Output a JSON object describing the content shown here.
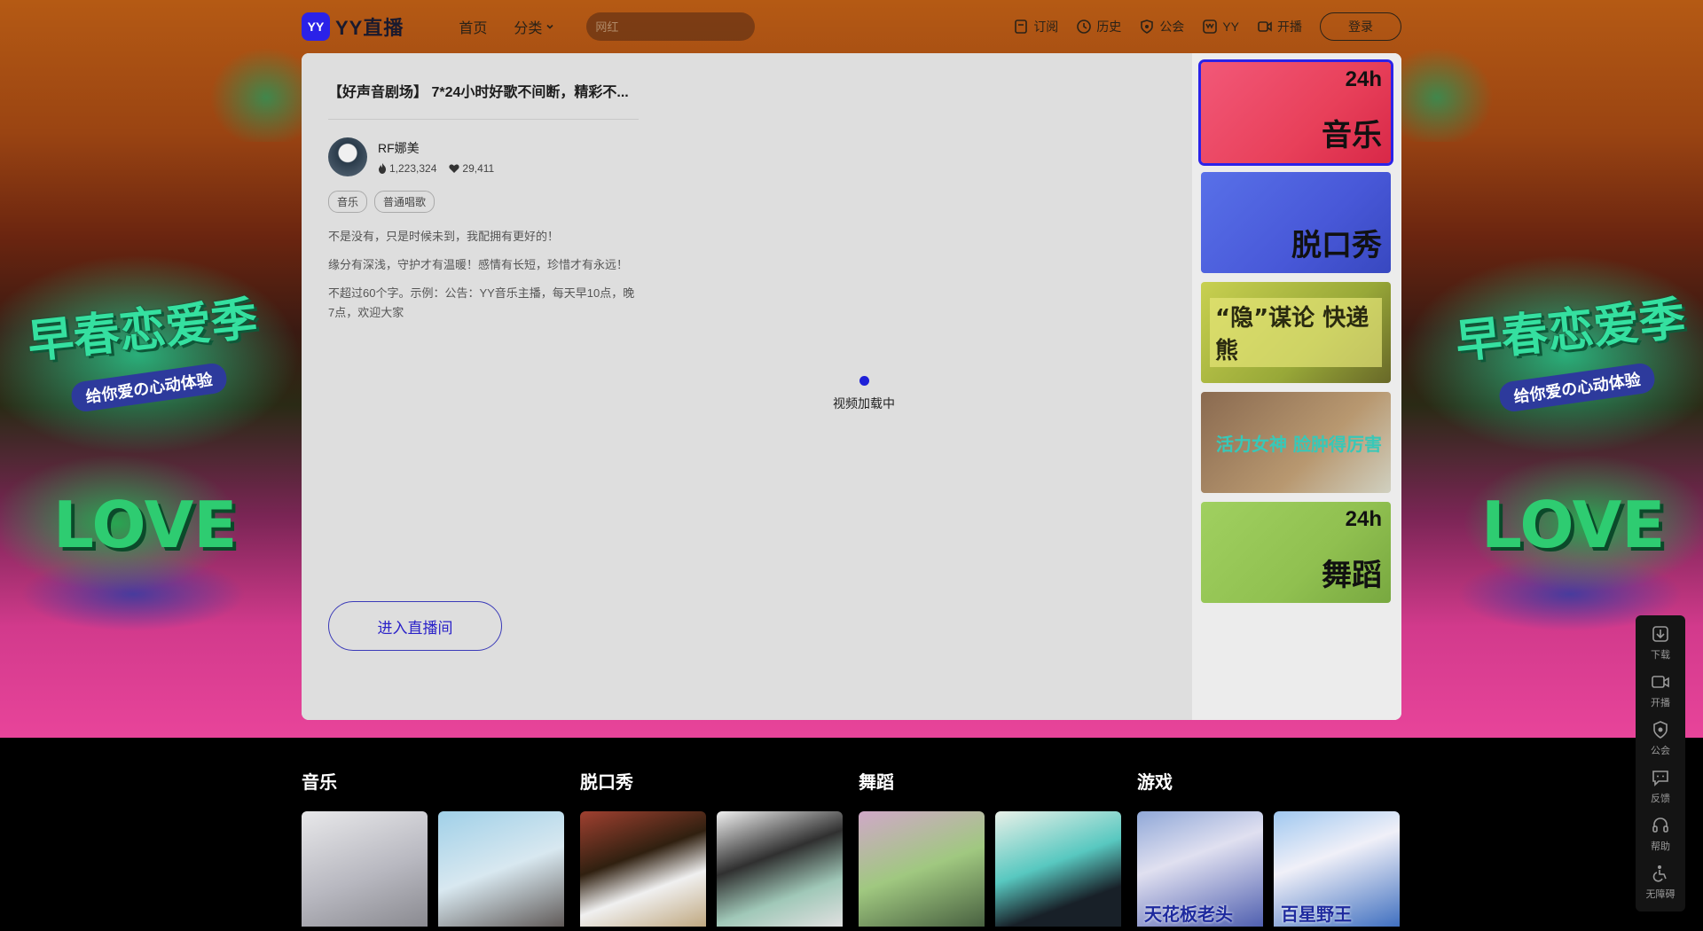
{
  "header": {
    "logo_badge": "YY",
    "logo_text": "YY直播",
    "nav": [
      {
        "label": "首页"
      },
      {
        "label": "分类"
      }
    ],
    "search_placeholder": "网红",
    "right_items": [
      {
        "label": "订阅",
        "icon": "bookmark-icon"
      },
      {
        "label": "历史",
        "icon": "clock-icon"
      },
      {
        "label": "公会",
        "icon": "shield-icon"
      },
      {
        "label": "YY",
        "icon": "yy-icon"
      },
      {
        "label": "开播",
        "icon": "video-camera-icon"
      }
    ],
    "login_label": "登录"
  },
  "background": {
    "title": "早春恋爱季",
    "subtitle": "给你爱の心动体验",
    "love": "LOVE"
  },
  "room": {
    "title": "【好声音剧场】 7*24小时好歌不间断，精彩不...",
    "anchor_name": "RF娜美",
    "heat": "1,223,324",
    "likes": "29,411",
    "tags": [
      "音乐",
      "普通唱歌"
    ],
    "descriptions": [
      "不是没有，只是时候未到，我配拥有更好的！",
      "缘分有深浅，守护才有温暖！感情有长短，珍惜才有永远！",
      "不超过60个字。示例：公告：YY音乐主播，每天早10点，晚7点，欢迎大家"
    ],
    "enter_label": "进入直播间",
    "loading_text": "视频加载中"
  },
  "sidebar_thumbs": [
    {
      "label": "音乐",
      "badge": "24h",
      "active": true
    },
    {
      "label": "脱口秀",
      "badge": "",
      "active": false
    },
    {
      "label": "“隐”谋论 快递熊",
      "badge": "",
      "active": false
    },
    {
      "label": "活力女神 脸肿得厉害",
      "badge": "",
      "active": false
    },
    {
      "label": "舞蹈",
      "badge": "24h",
      "active": false
    }
  ],
  "float_bar": [
    {
      "label": "下载",
      "icon": "download-icon"
    },
    {
      "label": "开播",
      "icon": "video-camera-icon"
    },
    {
      "label": "公会",
      "icon": "shield-icon"
    },
    {
      "label": "反馈",
      "icon": "feedback-icon"
    },
    {
      "label": "帮助",
      "icon": "headset-icon"
    },
    {
      "label": "无障碍",
      "icon": "accessibility-icon"
    }
  ],
  "categories": [
    {
      "title": "音乐",
      "cards": [
        {
          "caption": ""
        },
        {
          "caption": ""
        }
      ]
    },
    {
      "title": "脱口秀",
      "cards": [
        {
          "caption": ""
        },
        {
          "caption": ""
        }
      ]
    },
    {
      "title": "舞蹈",
      "cards": [
        {
          "caption": ""
        },
        {
          "caption": ""
        }
      ]
    },
    {
      "title": "游戏",
      "cards": [
        {
          "caption": "天花板老头"
        },
        {
          "caption": "百星野王"
        }
      ]
    }
  ],
  "colors": {
    "brand": "#2b22e8",
    "panel": "#dcdcdc"
  }
}
